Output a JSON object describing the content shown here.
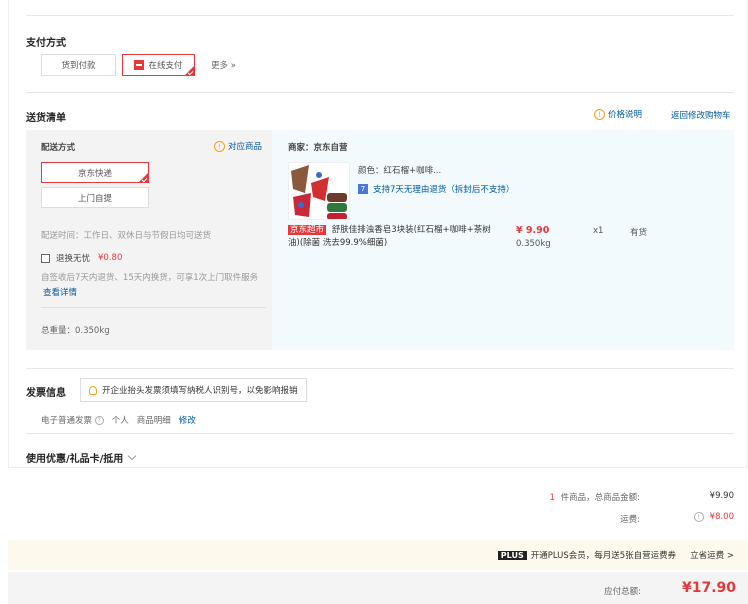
{
  "payment": {
    "title": "支付方式",
    "options": [
      "货到付款",
      "在线支付"
    ],
    "more": "更多 »"
  },
  "shipping_list": {
    "title": "送货清单",
    "price_note": "价格说明",
    "back_to_cart": "返回修改购物车",
    "delivery": {
      "label": "配送方式",
      "item_link": "对应商品",
      "options": [
        "京东快递",
        "上门自提"
      ],
      "time": "配送时间：工作日、双休日与节假日均可送货",
      "return_label": "退换无忧",
      "return_price": "¥0.80",
      "return_desc": "自签收后7天内退货、15天内换货，可享1次上门取件服务",
      "view_detail": "查看详情",
      "weight": "总重量：0.350kg"
    },
    "merchant": "商家：京东自营",
    "product": {
      "color": "颜色：红石榴+咖啡...",
      "return_support": "支持7天无理由退货（拆封后不支持）",
      "tag": "京东超市",
      "name": "舒肤佳排浊香皂3块装(红石榴+咖啡+茶树油)(除菌 洗去99.9%细菌)",
      "price": "¥ 9.90",
      "weight": "0.350kg",
      "qty": "x1",
      "stock": "有货"
    }
  },
  "invoice": {
    "title": "发票信息",
    "tip": "开企业抬头发票须填写纳税人识别号，以免影响报销",
    "type": "电子普通发票",
    "header": "个人",
    "content": "商品明细",
    "edit": "修改"
  },
  "coupon": {
    "title": "使用优惠/礼品卡/抵用"
  },
  "summary": {
    "count": "1",
    "count_label": "件商品，总商品金额:",
    "amount": "¥9.90",
    "freight_label": "运费:",
    "freight": "¥8.00"
  },
  "plus": {
    "badge": "PLUS",
    "text": "开通PLUS会员，每月送5张自营运费券",
    "action": "立省运费 >"
  },
  "total": {
    "label": "应付总额:",
    "amount": "¥17.90"
  },
  "colors": {
    "accent": "#e4393c",
    "link": "#005aa0",
    "plus_bg": "#fdf9ec"
  }
}
